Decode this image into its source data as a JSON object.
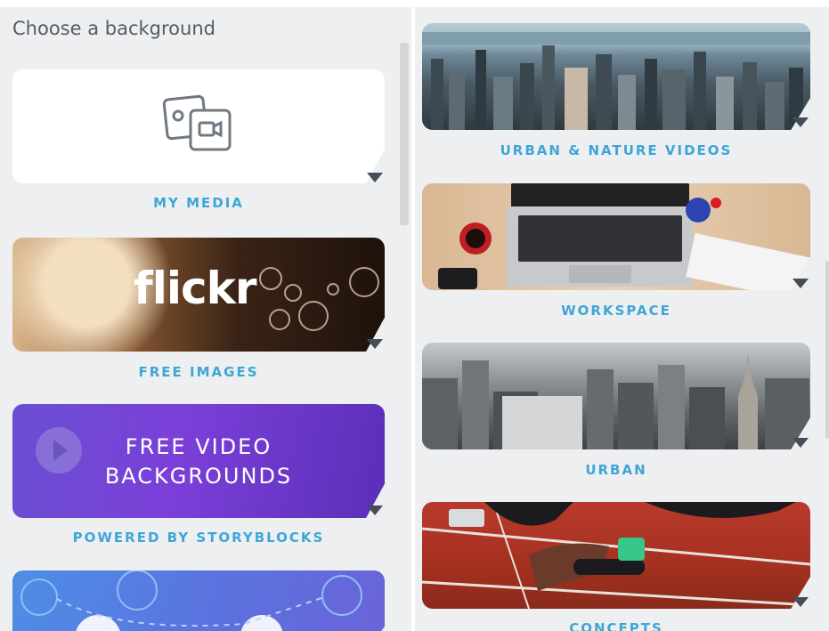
{
  "heading": "Choose a background",
  "left": {
    "cards": [
      {
        "label": "MY MEDIA"
      },
      {
        "label": "FREE IMAGES",
        "text": "flickr"
      },
      {
        "label": "POWERED BY STORYBLOCKS",
        "text_line1": "FREE VIDEO",
        "text_line2": "BACKGROUNDS"
      },
      {
        "label": ""
      }
    ]
  },
  "right": {
    "cards": [
      {
        "label": "URBAN & NATURE VIDEOS"
      },
      {
        "label": "WORKSPACE"
      },
      {
        "label": "URBAN"
      },
      {
        "label": "CONCEPTS"
      }
    ]
  },
  "colors": {
    "label": "#3ea6d7",
    "caret": "#434c58",
    "panel_bg": "#eeeff0"
  },
  "icons": [
    "media-icon",
    "caret-down-icon",
    "play-icon"
  ]
}
